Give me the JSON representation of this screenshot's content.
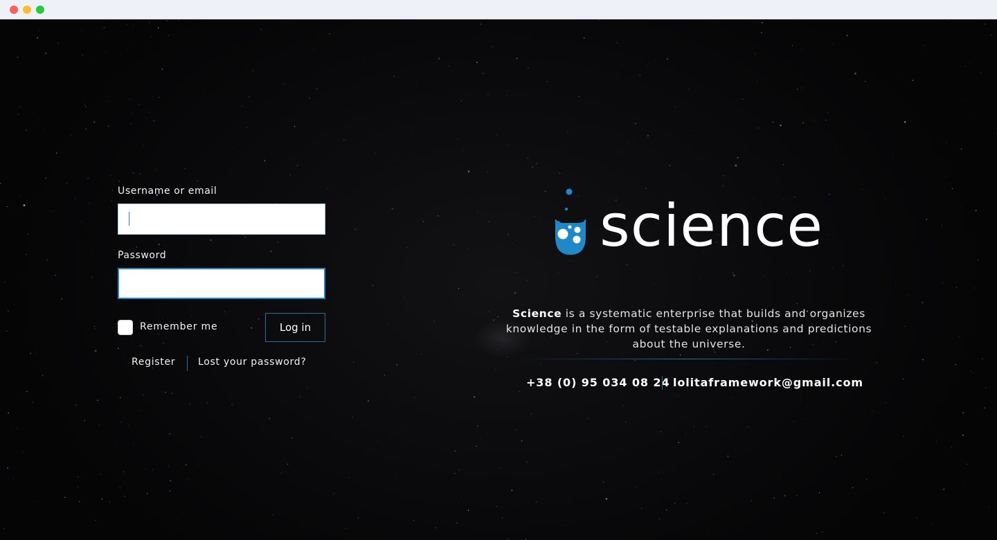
{
  "login": {
    "username_label": "Username or email",
    "username_value": "",
    "password_label": "Password",
    "password_value": "",
    "remember_label": "Remember me",
    "remember_checked": false,
    "login_button": "Log in",
    "register_link": "Register",
    "lost_password_link": "Lost your password?"
  },
  "brand": {
    "logo_text": "science",
    "tagline_strong": "Science",
    "tagline_rest": " is a systematic enterprise that builds and organizes knowledge in the form of testable explanations and predictions about the universe.",
    "phone": "+38 (0) 95 034 08 24",
    "email": "lolitaframework@gmail.com"
  },
  "colors": {
    "accent": "#1e88c8",
    "background": "#0a0a0c",
    "text": "#ffffff"
  },
  "icons": {
    "logo": "flask-bubbles-icon"
  }
}
